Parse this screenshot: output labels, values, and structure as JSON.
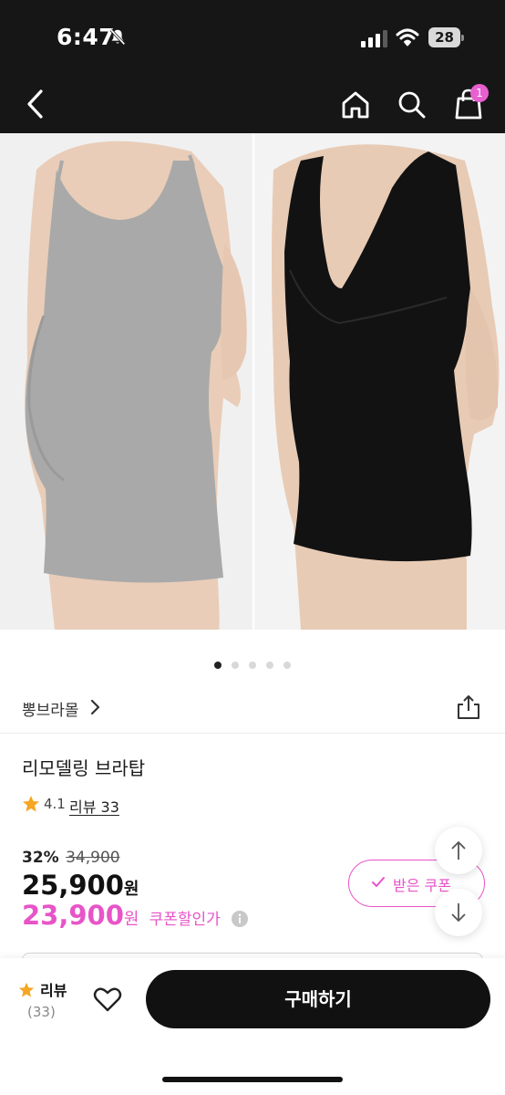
{
  "status_bar": {
    "time": "6:47",
    "battery_level": "28",
    "icons": [
      "bell-slash-icon",
      "signal-icon",
      "wifi-icon",
      "battery-icon"
    ]
  },
  "nav": {
    "icons": [
      "back-icon",
      "home-icon",
      "search-icon",
      "cart-icon"
    ],
    "cart_badge": "1"
  },
  "gallery": {
    "total_images": 5,
    "active_index": 0
  },
  "brand": {
    "name": "뽕브라몰"
  },
  "product": {
    "title": "리모델링 브라탑",
    "rating": "4.1",
    "review_link": "리뷰 33"
  },
  "price": {
    "discount_rate": "32%",
    "original_price": "34,900",
    "sale_price": "25,900",
    "currency": "원",
    "coupon_price": "23,900",
    "coupon_label": "쿠폰할인가"
  },
  "coupon_button": {
    "label": "받은 쿠폰"
  },
  "bottom_bar": {
    "review_label": "리뷰",
    "review_count": "(33)",
    "buy_label": "구매하기"
  },
  "colors": {
    "accent_pink": "#e854c8",
    "badge_pink": "#e85fd0",
    "dark": "#161616",
    "star": "#f5a623"
  }
}
